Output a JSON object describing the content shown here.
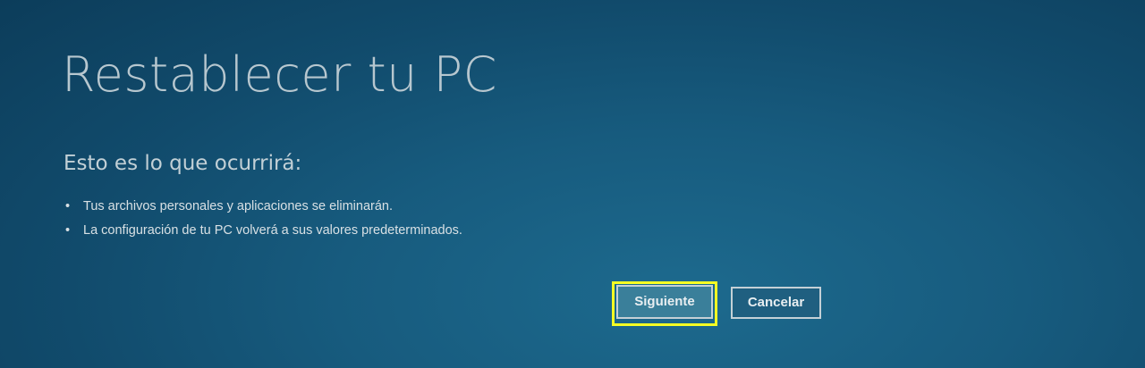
{
  "dialog": {
    "title": "Restablecer tu PC",
    "subtitle": "Esto es lo que ocurrirá:",
    "bullet_char": "•",
    "items": [
      "Tus archivos personales y aplicaciones se eliminarán.",
      "La configuración de tu PC volverá a sus valores predeterminados."
    ]
  },
  "buttons": {
    "next_label": "Siguiente",
    "cancel_label": "Cancelar"
  },
  "colors": {
    "background": "#175b7e",
    "focus_highlight": "#f4ff24",
    "text": "#dfe6ea"
  }
}
